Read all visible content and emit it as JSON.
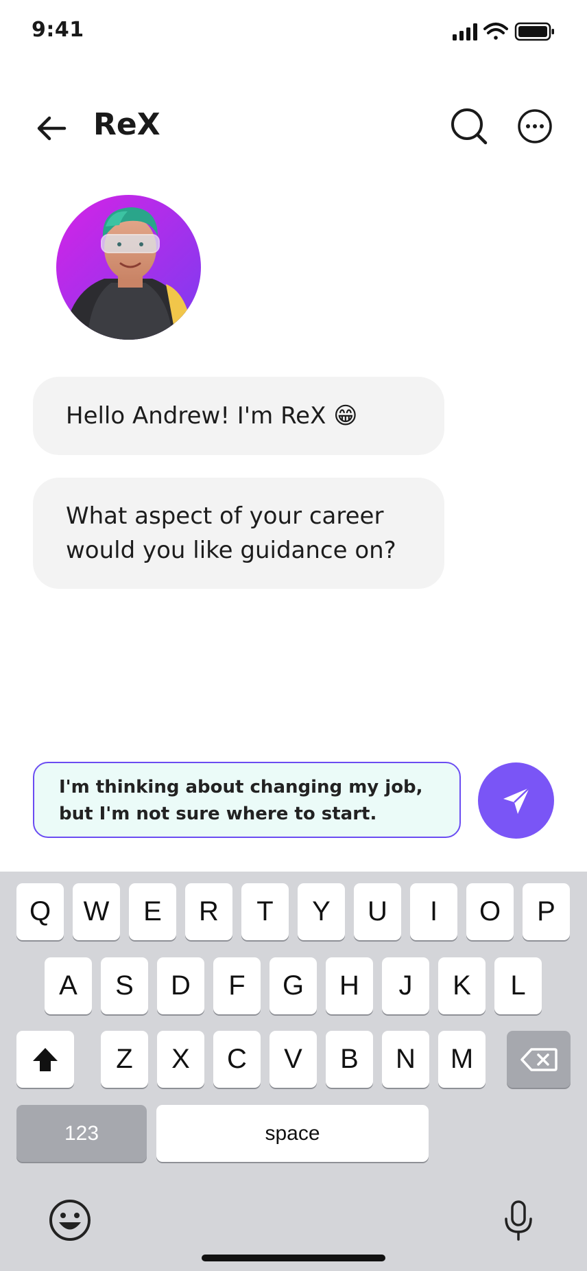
{
  "status_bar": {
    "time": "9:41"
  },
  "header": {
    "title": "ReX"
  },
  "chat": {
    "messages": [
      {
        "text": "Hello Andrew! I'm ReX 😁"
      },
      {
        "text": "What aspect of your career would you like guidance on?"
      }
    ]
  },
  "composer": {
    "input_value": "I'm thinking about changing my job, but I'm not sure where to start."
  },
  "keyboard": {
    "row1": [
      "Q",
      "W",
      "E",
      "R",
      "T",
      "Y",
      "U",
      "I",
      "O",
      "P"
    ],
    "row2": [
      "A",
      "S",
      "D",
      "F",
      "G",
      "H",
      "J",
      "K",
      "L"
    ],
    "row3": [
      "Z",
      "X",
      "C",
      "V",
      "B",
      "N",
      "M"
    ],
    "numbers_label": "123",
    "space_label": "space"
  },
  "colors": {
    "accent": "#7a55f6",
    "input_bg": "#ebfbf8",
    "bubble_bg": "#f3f3f3",
    "keyboard_bg": "#d4d5d9"
  }
}
